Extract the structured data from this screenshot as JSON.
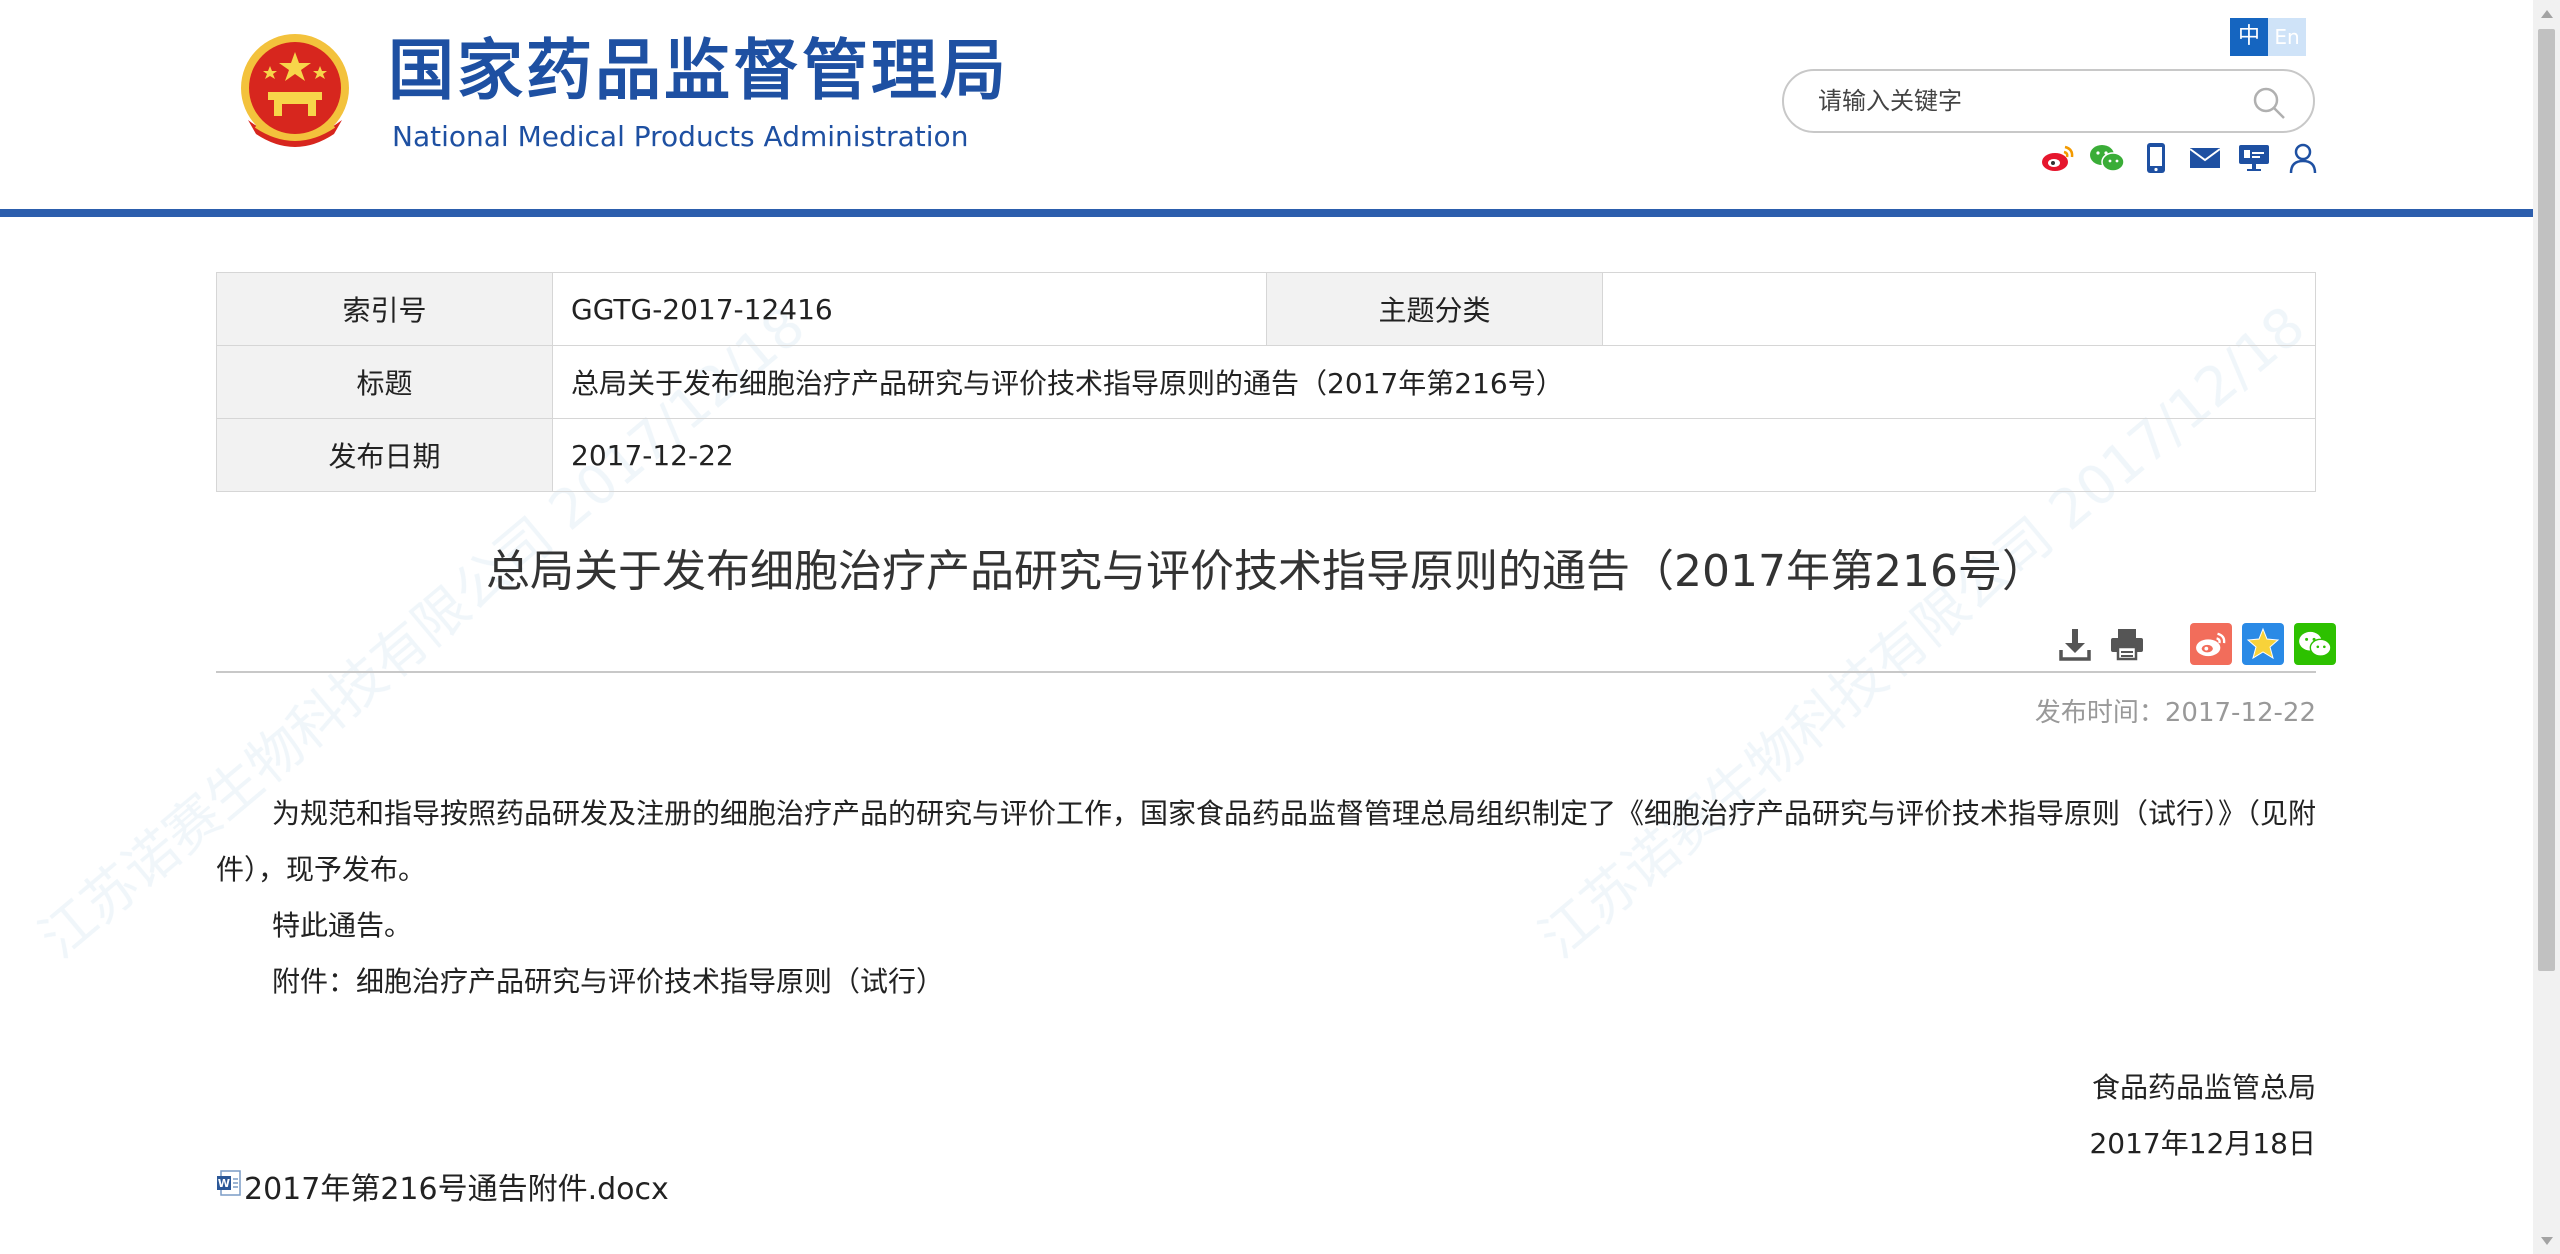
{
  "header": {
    "site_name_cn": "国家药品监督管理局",
    "site_name_en": "National Medical Products Administration",
    "lang_cn": "中",
    "lang_en": "En",
    "search_placeholder": "请输入关键字",
    "brand_color": "#1e50a2",
    "rule_color": "#2c5ead",
    "social_icons": [
      "weibo-icon",
      "wechat-icon",
      "mobile-icon",
      "mail-icon",
      "screen-icon",
      "user-icon"
    ]
  },
  "info_table": {
    "rows": [
      {
        "label": "索引号",
        "value": "GGTG-2017-12416",
        "label2": "主题分类",
        "value2": ""
      },
      {
        "label": "标题",
        "value": "总局关于发布细胞治疗产品研究与评价技术指导原则的通告（2017年第216号）"
      },
      {
        "label": "发布日期",
        "value": "2017-12-22"
      }
    ]
  },
  "article": {
    "title": "总局关于发布细胞治疗产品研究与评价技术指导原则的通告（2017年第216号）",
    "publish_time": "发布时间：2017-12-22",
    "tool_icons": [
      "download-icon",
      "print-icon"
    ],
    "share_icons": [
      {
        "name": "weibo-share-icon",
        "color": "#f26d5b"
      },
      {
        "name": "qzone-share-icon",
        "color": "#2a8ae6"
      },
      {
        "name": "wechat-share-icon",
        "color": "#2dc100"
      }
    ],
    "paragraphs": [
      "为规范和指导按照药品研发及注册的细胞治疗产品的研究与评价工作，国家食品药品监督管理总局组织制定了《细胞治疗产品研究与评价技术指导原则（试行）》（见附件），现予发布。",
      "特此通告。",
      "附件：细胞治疗产品研究与评价技术指导原则（试行）"
    ],
    "signature_org": "食品药品监管总局",
    "signature_date": "2017年12月18日",
    "attachment_name": "2017年第216号通告附件.docx"
  }
}
